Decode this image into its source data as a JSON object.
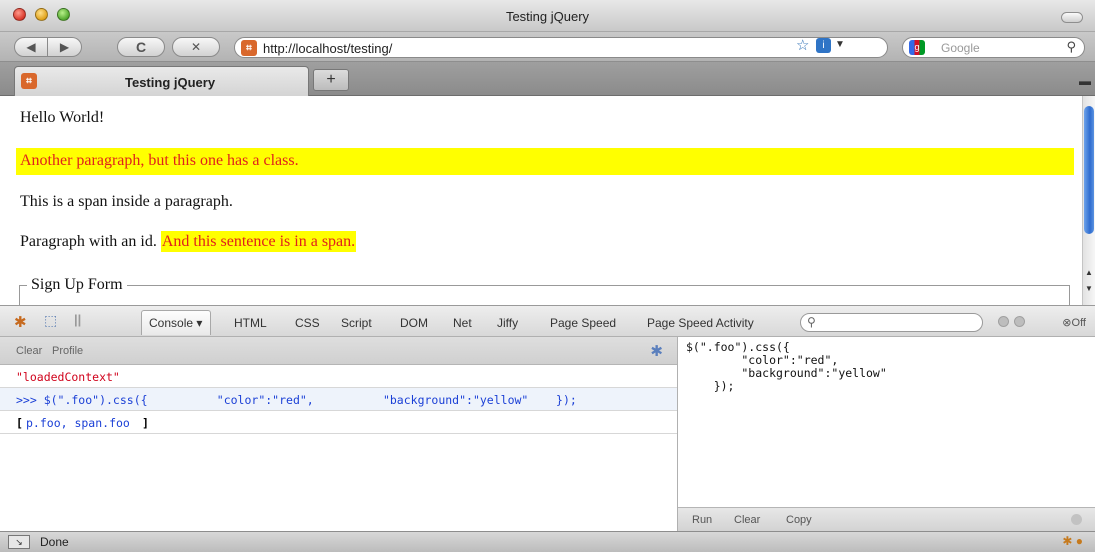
{
  "window": {
    "title": "Testing jQuery"
  },
  "nav": {
    "back_icon": "back-arrow-icon",
    "forward_icon": "forward-arrow-icon",
    "reload_icon": "reload-icon",
    "stop_icon": "stop-icon",
    "url": "http://localhost/testing/",
    "search_placeholder": "Google"
  },
  "tabs": [
    {
      "label": "Testing jQuery"
    }
  ],
  "page": {
    "p1": "Hello World!",
    "p2": "Another paragraph, but this one has a class.",
    "p3": "This is a span inside a paragraph.",
    "p4_text": "Paragraph with an id.",
    "p4_span": "And this sentence is in a span.",
    "legend": "Sign Up Form",
    "highlight_bg": "#ffff00",
    "highlight_fg": "#e0221b"
  },
  "firebug": {
    "tabs": [
      "Console",
      "HTML",
      "CSS",
      "Script",
      "DOM",
      "Net",
      "Jiffy",
      "Page Speed",
      "Page Speed Activity"
    ],
    "off_label": "Off",
    "console_actions": {
      "clear": "Clear",
      "profile": "Profile"
    },
    "log": {
      "loaded": "\"loadedContext\"",
      "command": ">>> $(\".foo\").css({          \"color\":\"red\",          \"background\":\"yellow\"    });",
      "result_open": "[",
      "result_items": "p.foo, span.foo",
      "result_close": "]"
    },
    "editor_code": "$(\".foo\").css({\n        \"color\":\"red\",\n        \"background\":\"yellow\"\n    });",
    "editor_actions": {
      "run": "Run",
      "clear": "Clear",
      "copy": "Copy"
    }
  },
  "status": {
    "text": "Done"
  }
}
